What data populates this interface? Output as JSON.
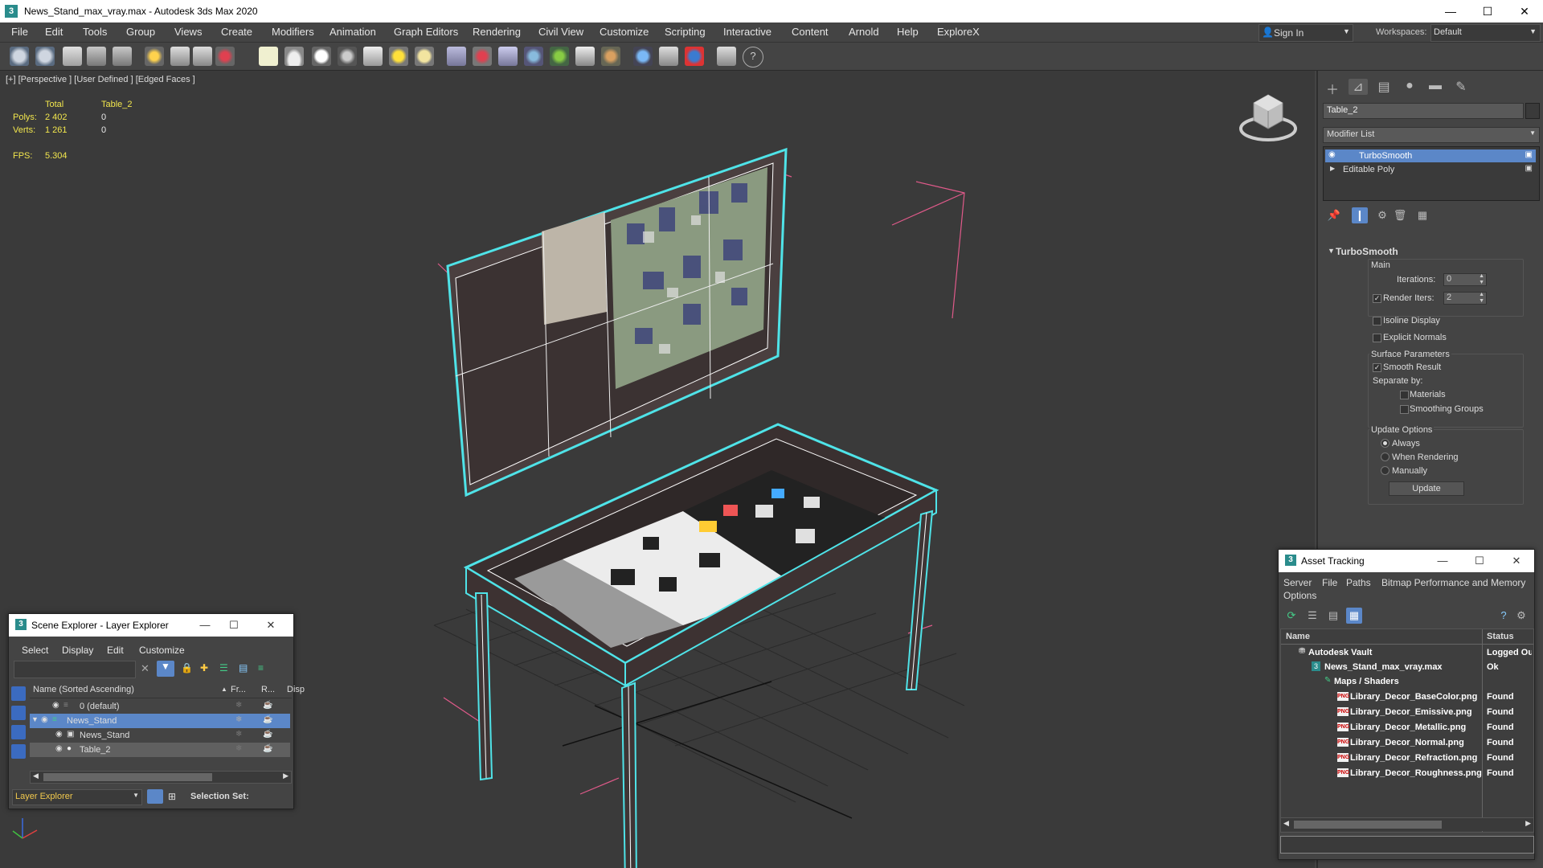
{
  "window": {
    "title": "News_Stand_max_vray.max - Autodesk 3ds Max 2020",
    "app_icon": "3",
    "minimize": "—",
    "maximize": "☐",
    "close": "✕"
  },
  "menu": [
    "File",
    "Edit",
    "Tools",
    "Group",
    "Views",
    "Create",
    "Modifiers",
    "Animation",
    "Graph Editors",
    "Rendering",
    "Civil View",
    "Customize",
    "Scripting",
    "Interactive",
    "Content",
    "Arnold",
    "Help",
    "ExploreX"
  ],
  "account": {
    "signin_label": "Sign In",
    "workspaces_label": "Workspaces:",
    "workspace_value": "Default"
  },
  "viewport": {
    "label": "[+] [Perspective ] [User Defined ] [Edged Faces ]",
    "stats": {
      "total_label": "Total",
      "object_label": "Table_2",
      "polys_label": "Polys:",
      "polys_total": "2 402",
      "polys_object": "0",
      "verts_label": "Verts:",
      "verts_total": "1 261",
      "verts_object": "0",
      "fps_label": "FPS:",
      "fps_value": "5.304"
    }
  },
  "command_panel": {
    "object_name": "Table_2",
    "modifier_list_label": "Modifier List",
    "stack": [
      "TurboSmooth",
      "Editable Poly"
    ],
    "rollout_title": "TurboSmooth",
    "main_group": "Main",
    "iterations_label": "Iterations:",
    "iterations_value": "0",
    "render_iters_label": "Render Iters:",
    "render_iters_value": "2",
    "isoline_label": "Isoline Display",
    "explicit_normals_label": "Explicit Normals",
    "surface_group": "Surface Parameters",
    "smooth_result_label": "Smooth Result",
    "separate_by_label": "Separate by:",
    "materials_label": "Materials",
    "smoothing_groups_label": "Smoothing Groups",
    "update_group": "Update Options",
    "always_label": "Always",
    "when_rendering_label": "When Rendering",
    "manually_label": "Manually",
    "update_button": "Update"
  },
  "scene_explorer": {
    "title": "Scene Explorer - Layer Explorer",
    "menu": [
      "Select",
      "Display",
      "Edit",
      "Customize"
    ],
    "columns": [
      "Name (Sorted Ascending)",
      "Fr...",
      "R...",
      "Disp"
    ],
    "rows": [
      "0 (default)",
      "News_Stand",
      "News_Stand",
      "Table_2"
    ],
    "footer_dropdown": "Layer Explorer",
    "selection_set_label": "Selection Set:"
  },
  "asset_tracking": {
    "title": "Asset Tracking",
    "menu": [
      "Server",
      "File",
      "Paths",
      "Bitmap Performance and Memory",
      "Options"
    ],
    "columns": [
      "Name",
      "Status"
    ],
    "rows": [
      {
        "name": "Autodesk Vault",
        "status": "Logged Ou"
      },
      {
        "name": "News_Stand_max_vray.max",
        "status": "Ok"
      },
      {
        "name": "Maps / Shaders",
        "status": ""
      },
      {
        "name": "Library_Decor_BaseColor.png",
        "status": "Found"
      },
      {
        "name": "Library_Decor_Emissive.png",
        "status": "Found"
      },
      {
        "name": "Library_Decor_Metallic.png",
        "status": "Found"
      },
      {
        "name": "Library_Decor_Normal.png",
        "status": "Found"
      },
      {
        "name": "Library_Decor_Refraction.png",
        "status": "Found"
      },
      {
        "name": "Library_Decor_Roughness.png",
        "status": "Found"
      }
    ],
    "png_badge": "PNG"
  },
  "colors": {
    "accent": "#5b87c8",
    "selection_wire": "#4fe3e8",
    "stat_yellow": "#f2e64d"
  }
}
